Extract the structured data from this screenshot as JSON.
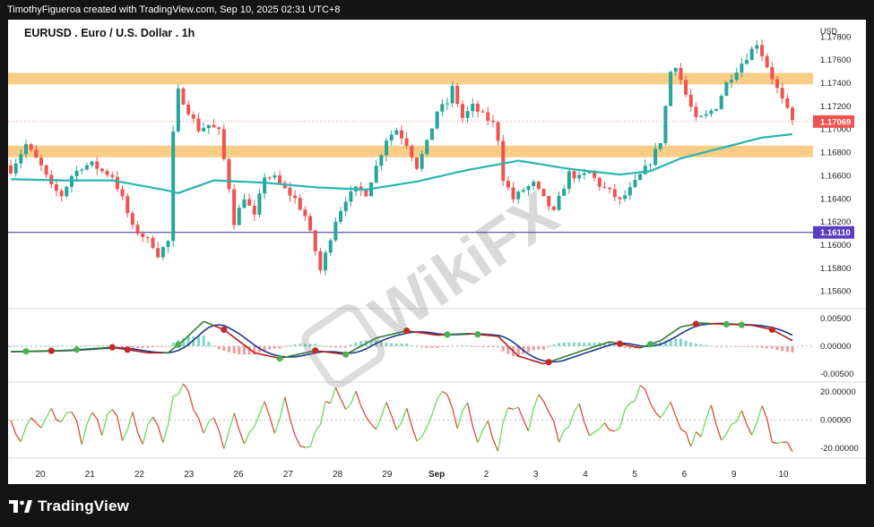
{
  "header": {
    "caption": "TimothyFigueroa created with TradingView.com, Sep 10, 2025 02:31 UTC+8"
  },
  "footer": {
    "brand": "TradingView"
  },
  "watermark": {
    "text": "WikiFX"
  },
  "colors": {
    "bull": "#26a69a",
    "bear": "#ef5350",
    "ma": "#26b5b0",
    "zone": "#f8c471",
    "macd_fast": "#2e7d32",
    "macd_slow": "#1e3a8a",
    "osc_up": "#66dd55",
    "osc_down": "#e04838",
    "price_tag": "#ef5350",
    "level_tag": "#5b3cc4",
    "dot_up": "#4caf50",
    "dot_down": "#c62828"
  },
  "chart_data": [
    {
      "type": "candlestick",
      "title": "EURUSD . Euro / U.S. Dollar . 1h",
      "currency_label": "USD",
      "ylim": [
        1.1545,
        1.1795
      ],
      "yticks": [
        "1.17800",
        "1.17600",
        "1.17400",
        "1.17200",
        "1.17000",
        "1.16800",
        "1.16600",
        "1.16400",
        "1.16200",
        "1.16000",
        "1.15800",
        "1.15600"
      ],
      "x_labels": [
        "20",
        "21",
        "22",
        "23",
        "26",
        "27",
        "28",
        "29",
        "Sep",
        "2",
        "3",
        "4",
        "5",
        "6",
        "9",
        "10"
      ],
      "current_price": "1.17069",
      "horizontal_level": "1.16110",
      "resistance_zones": [
        [
          1.1739,
          1.1749
        ],
        [
          1.1676,
          1.1686
        ]
      ],
      "close_anchors": [
        [
          0,
          1.1665
        ],
        [
          3,
          1.1687
        ],
        [
          6,
          1.1668
        ],
        [
          8,
          1.165
        ],
        [
          10,
          1.1643
        ],
        [
          12,
          1.166
        ],
        [
          14,
          1.1668
        ],
        [
          16,
          1.167
        ],
        [
          18,
          1.1664
        ],
        [
          20,
          1.166
        ],
        [
          22,
          1.164
        ],
        [
          24,
          1.1615
        ],
        [
          26,
          1.1608
        ],
        [
          28,
          1.16
        ],
        [
          29,
          1.1592
        ],
        [
          31,
          1.1603
        ],
        [
          32,
          1.1696
        ],
        [
          33,
          1.1733
        ],
        [
          35,
          1.1716
        ],
        [
          37,
          1.17
        ],
        [
          39,
          1.1704
        ],
        [
          41,
          1.1698
        ],
        [
          43,
          1.165
        ],
        [
          44,
          1.162
        ],
        [
          46,
          1.1642
        ],
        [
          48,
          1.1624
        ],
        [
          50,
          1.166
        ],
        [
          52,
          1.1658
        ],
        [
          54,
          1.1648
        ],
        [
          56,
          1.164
        ],
        [
          58,
          1.1625
        ],
        [
          60,
          1.1595
        ],
        [
          61,
          1.1578
        ],
        [
          62,
          1.1592
        ],
        [
          64,
          1.1622
        ],
        [
          66,
          1.164
        ],
        [
          68,
          1.1648
        ],
        [
          70,
          1.1645
        ],
        [
          72,
          1.1668
        ],
        [
          74,
          1.1692
        ],
        [
          76,
          1.17
        ],
        [
          78,
          1.1688
        ],
        [
          80,
          1.1668
        ],
        [
          82,
          1.1688
        ],
        [
          84,
          1.1716
        ],
        [
          86,
          1.1723
        ],
        [
          87,
          1.1736
        ],
        [
          89,
          1.171
        ],
        [
          91,
          1.172
        ],
        [
          93,
          1.1712
        ],
        [
          95,
          1.1705
        ],
        [
          96,
          1.1692
        ],
        [
          97,
          1.1658
        ],
        [
          99,
          1.164
        ],
        [
          101,
          1.1648
        ],
        [
          103,
          1.1653
        ],
        [
          105,
          1.164
        ],
        [
          107,
          1.1628
        ],
        [
          108,
          1.164
        ],
        [
          110,
          1.1662
        ],
        [
          112,
          1.1658
        ],
        [
          114,
          1.1663
        ],
        [
          116,
          1.1652
        ],
        [
          118,
          1.1646
        ],
        [
          120,
          1.1638
        ],
        [
          122,
          1.1648
        ],
        [
          124,
          1.166
        ],
        [
          126,
          1.1672
        ],
        [
          128,
          1.169
        ],
        [
          130,
          1.175
        ],
        [
          131,
          1.1756
        ],
        [
          133,
          1.173
        ],
        [
          135,
          1.1708
        ],
        [
          137,
          1.1712
        ],
        [
          139,
          1.172
        ],
        [
          141,
          1.174
        ],
        [
          143,
          1.1752
        ],
        [
          145,
          1.1763
        ],
        [
          147,
          1.1775
        ],
        [
          148,
          1.1765
        ],
        [
          150,
          1.1745
        ],
        [
          152,
          1.1725
        ],
        [
          154,
          1.1707
        ]
      ],
      "ma": {
        "name": "MA",
        "anchors": [
          [
            0,
            1.1657
          ],
          [
            10,
            1.1656
          ],
          [
            20,
            1.1656
          ],
          [
            30,
            1.1648
          ],
          [
            33,
            1.1645
          ],
          [
            40,
            1.1656
          ],
          [
            50,
            1.1654
          ],
          [
            60,
            1.165
          ],
          [
            70,
            1.1648
          ],
          [
            80,
            1.1655
          ],
          [
            90,
            1.1665
          ],
          [
            100,
            1.1673
          ],
          [
            110,
            1.1666
          ],
          [
            120,
            1.1661
          ],
          [
            126,
            1.1664
          ],
          [
            132,
            1.1675
          ],
          [
            140,
            1.1684
          ],
          [
            148,
            1.1693
          ],
          [
            154,
            1.1696
          ]
        ]
      }
    },
    {
      "type": "macd",
      "ylim": [
        -0.0065,
        0.0068
      ],
      "yticks": [
        "0.00500",
        "0.00000",
        "-0.00500"
      ],
      "fast_anchors": [
        [
          0,
          -0.001
        ],
        [
          10,
          -0.0008
        ],
        [
          20,
          -0.0002
        ],
        [
          27,
          -0.0012
        ],
        [
          31,
          -0.0012
        ],
        [
          34,
          0.001
        ],
        [
          38,
          0.0045
        ],
        [
          42,
          0.003
        ],
        [
          48,
          -0.0012
        ],
        [
          53,
          -0.0022
        ],
        [
          60,
          -0.0008
        ],
        [
          66,
          -0.0015
        ],
        [
          72,
          0.0015
        ],
        [
          78,
          0.0028
        ],
        [
          84,
          0.002
        ],
        [
          90,
          0.0023
        ],
        [
          96,
          0.0018
        ],
        [
          100,
          -0.0018
        ],
        [
          105,
          -0.0032
        ],
        [
          112,
          -0.001
        ],
        [
          118,
          0.0008
        ],
        [
          124,
          -0.0003
        ],
        [
          128,
          0.001
        ],
        [
          132,
          0.0035
        ],
        [
          136,
          0.0042
        ],
        [
          140,
          0.004
        ],
        [
          146,
          0.0038
        ],
        [
          150,
          0.003
        ],
        [
          154,
          0.001
        ]
      ],
      "slow_offset": 2,
      "dots": [
        [
          3,
          1
        ],
        [
          8,
          0
        ],
        [
          13,
          1
        ],
        [
          20,
          0
        ],
        [
          23,
          0
        ],
        [
          33,
          1
        ],
        [
          42,
          0
        ],
        [
          53,
          1
        ],
        [
          60,
          0
        ],
        [
          66,
          1
        ],
        [
          78,
          0
        ],
        [
          86,
          1
        ],
        [
          92,
          1
        ],
        [
          106,
          0
        ],
        [
          120,
          0
        ],
        [
          126,
          1
        ],
        [
          135,
          0
        ],
        [
          141,
          1
        ],
        [
          144,
          1
        ],
        [
          150,
          0
        ]
      ]
    },
    {
      "type": "oscillator",
      "ylim": [
        -27,
        27
      ],
      "yticks": [
        "20.00000",
        "0.00000",
        "-20.00000"
      ],
      "anchors": [
        [
          0,
          0
        ],
        [
          2,
          -12
        ],
        [
          4,
          4
        ],
        [
          6,
          -8
        ],
        [
          8,
          12
        ],
        [
          10,
          -5
        ],
        [
          12,
          9
        ],
        [
          14,
          -14
        ],
        [
          16,
          6
        ],
        [
          18,
          -9
        ],
        [
          20,
          11
        ],
        [
          22,
          -13
        ],
        [
          24,
          3
        ],
        [
          26,
          -16
        ],
        [
          28,
          4
        ],
        [
          30,
          -18
        ],
        [
          32,
          16
        ],
        [
          34,
          26
        ],
        [
          36,
          10
        ],
        [
          38,
          -9
        ],
        [
          40,
          3
        ],
        [
          42,
          -20
        ],
        [
          44,
          6
        ],
        [
          46,
          -15
        ],
        [
          48,
          -4
        ],
        [
          50,
          13
        ],
        [
          52,
          -12
        ],
        [
          54,
          16
        ],
        [
          56,
          -8
        ],
        [
          58,
          -22
        ],
        [
          60,
          -11
        ],
        [
          62,
          12
        ],
        [
          64,
          20
        ],
        [
          66,
          9
        ],
        [
          68,
          18
        ],
        [
          70,
          4
        ],
        [
          72,
          -10
        ],
        [
          74,
          14
        ],
        [
          76,
          -6
        ],
        [
          78,
          8
        ],
        [
          80,
          -18
        ],
        [
          82,
          -8
        ],
        [
          84,
          16
        ],
        [
          86,
          18
        ],
        [
          88,
          -6
        ],
        [
          90,
          12
        ],
        [
          92,
          -16
        ],
        [
          94,
          -4
        ],
        [
          96,
          -20
        ],
        [
          98,
          12
        ],
        [
          100,
          6
        ],
        [
          102,
          -8
        ],
        [
          104,
          18
        ],
        [
          106,
          4
        ],
        [
          108,
          -12
        ],
        [
          110,
          -4
        ],
        [
          112,
          14
        ],
        [
          114,
          -12
        ],
        [
          116,
          -3
        ],
        [
          118,
          -8
        ],
        [
          120,
          -2
        ],
        [
          122,
          12
        ],
        [
          124,
          22
        ],
        [
          126,
          16
        ],
        [
          128,
          2
        ],
        [
          130,
          10
        ],
        [
          132,
          -4
        ],
        [
          134,
          -16
        ],
        [
          136,
          -8
        ],
        [
          138,
          10
        ],
        [
          140,
          -12
        ],
        [
          142,
          -4
        ],
        [
          144,
          6
        ],
        [
          146,
          -12
        ],
        [
          148,
          10
        ],
        [
          150,
          -13
        ],
        [
          152,
          -18
        ],
        [
          154,
          -20
        ]
      ]
    }
  ]
}
